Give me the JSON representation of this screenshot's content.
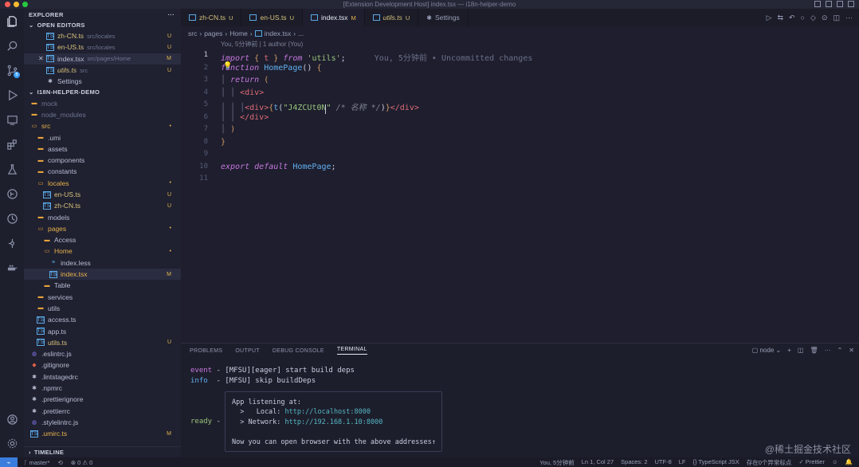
{
  "window": {
    "title": "[Extension Development Host] index.tsx — i18n-helper-demo"
  },
  "sidebar": {
    "explorer_label": "EXPLORER",
    "more": "···",
    "open_editors_label": "OPEN EDITORS",
    "open_editors": [
      {
        "name": "zh-CN.ts",
        "path": "src/locales",
        "status": "U",
        "icon": "ts-file-icon"
      },
      {
        "name": "en-US.ts",
        "path": "src/locales",
        "status": "U",
        "icon": "ts-file-icon"
      },
      {
        "name": "index.tsx",
        "path": "src/pages/Home",
        "status": "M",
        "icon": "ts-file-icon",
        "close": "✕"
      },
      {
        "name": "utils.ts",
        "path": "src",
        "status": "U",
        "icon": "ts-file-icon"
      },
      {
        "name": "Settings",
        "path": "",
        "status": "",
        "icon": "settings-icon"
      }
    ],
    "project_label": "I18N-HELPER-DEMO",
    "tree": [
      {
        "name": "mock",
        "indent": 0,
        "kind": "folder",
        "status": ""
      },
      {
        "name": "node_modules",
        "indent": 0,
        "kind": "folder",
        "status": ""
      },
      {
        "name": "src",
        "indent": 0,
        "kind": "folder-open",
        "status": "•"
      },
      {
        "name": ".umi",
        "indent": 1,
        "kind": "folder",
        "status": ""
      },
      {
        "name": "assets",
        "indent": 1,
        "kind": "folder",
        "status": ""
      },
      {
        "name": "components",
        "indent": 1,
        "kind": "folder",
        "status": ""
      },
      {
        "name": "constants",
        "indent": 1,
        "kind": "folder",
        "status": ""
      },
      {
        "name": "locales",
        "indent": 1,
        "kind": "folder-open",
        "status": "•"
      },
      {
        "name": "en-US.ts",
        "indent": 2,
        "kind": "ts",
        "status": "U"
      },
      {
        "name": "zh-CN.ts",
        "indent": 2,
        "kind": "ts",
        "status": "U"
      },
      {
        "name": "models",
        "indent": 1,
        "kind": "folder",
        "status": ""
      },
      {
        "name": "pages",
        "indent": 1,
        "kind": "folder-open",
        "status": "•"
      },
      {
        "name": "Access",
        "indent": 2,
        "kind": "folder",
        "status": ""
      },
      {
        "name": "Home",
        "indent": 2,
        "kind": "folder-open",
        "status": "•"
      },
      {
        "name": "index.less",
        "indent": 3,
        "kind": "less",
        "status": ""
      },
      {
        "name": "index.tsx",
        "indent": 3,
        "kind": "ts",
        "status": "M"
      },
      {
        "name": "Table",
        "indent": 2,
        "kind": "folder",
        "status": ""
      },
      {
        "name": "services",
        "indent": 1,
        "kind": "folder",
        "status": ""
      },
      {
        "name": "utils",
        "indent": 1,
        "kind": "folder",
        "status": ""
      },
      {
        "name": "access.ts",
        "indent": 1,
        "kind": "ts",
        "status": ""
      },
      {
        "name": "app.ts",
        "indent": 1,
        "kind": "ts",
        "status": ""
      },
      {
        "name": "utils.ts",
        "indent": 1,
        "kind": "ts",
        "status": "U"
      },
      {
        "name": ".eslintrc.js",
        "indent": 0,
        "kind": "js",
        "status": ""
      },
      {
        "name": ".gitignore",
        "indent": 0,
        "kind": "git",
        "status": ""
      },
      {
        "name": ".lintstagedrc",
        "indent": 0,
        "kind": "cfg",
        "status": ""
      },
      {
        "name": ".npmrc",
        "indent": 0,
        "kind": "cfg",
        "status": ""
      },
      {
        "name": ".prettierignore",
        "indent": 0,
        "kind": "cfg",
        "status": ""
      },
      {
        "name": ".prettierrc",
        "indent": 0,
        "kind": "cfg",
        "status": ""
      },
      {
        "name": ".stylelintrc.js",
        "indent": 0,
        "kind": "js",
        "status": ""
      },
      {
        "name": ".umirc.ts",
        "indent": 0,
        "kind": "ts",
        "status": "M"
      }
    ],
    "timeline_label": "TIMELINE"
  },
  "tabs": [
    {
      "name": "zh-CN.ts",
      "tag": "U",
      "active": false
    },
    {
      "name": "en-US.ts",
      "tag": "U",
      "active": false
    },
    {
      "name": "index.tsx",
      "tag": "M",
      "active": true
    },
    {
      "name": "utils.ts",
      "tag": "U",
      "active": false
    },
    {
      "name": "Settings",
      "tag": "",
      "active": false
    }
  ],
  "breadcrumb": {
    "a": "src",
    "b": "pages",
    "c": "Home",
    "d": "index.tsx",
    "e": "..."
  },
  "editor": {
    "blame_hint": "You, 5分钟前 | 1 author (You)",
    "inline_blame": "You, 5分钟前 • Uncommitted changes",
    "line_numbers": [
      "1",
      "2",
      "3",
      "4",
      "5",
      "6",
      "7",
      "8",
      "9",
      "10",
      "11"
    ]
  },
  "panel": {
    "tabs": [
      "PROBLEMS",
      "OUTPUT",
      "DEBUG CONSOLE",
      "TERMINAL"
    ],
    "terminal_name": "node",
    "line1_tag": "event",
    "line1_text": " - [MFSU][eager] start build deps",
    "line2_tag": "info",
    "line2_text": "  - [MFSU] skip buildDeps",
    "ready_tag": "ready",
    "ready_dash": " -",
    "box_title": "App listening at:",
    "box_local_label": "  >   Local: ",
    "box_local_url": "http://localhost:8000",
    "box_network_label": "  > Network: ",
    "box_network_url": "http://192.168.1.10:8000",
    "box_footer": "Now you can open browser with the above addresses↑"
  },
  "status": {
    "branch": "master*",
    "sync": "⟲",
    "problems": "⊗ 0 ⚠ 0",
    "blame": "You, 5分钟前",
    "position": "Ln 1, Col 27",
    "spaces": "Spaces: 2",
    "encoding": "UTF-8",
    "eol": "LF",
    "language": "{} TypeScript JSX",
    "exceptions": "存在0个异常标点",
    "prettier": "✓ Prettier"
  },
  "watermark": "@稀土掘金技术社区"
}
